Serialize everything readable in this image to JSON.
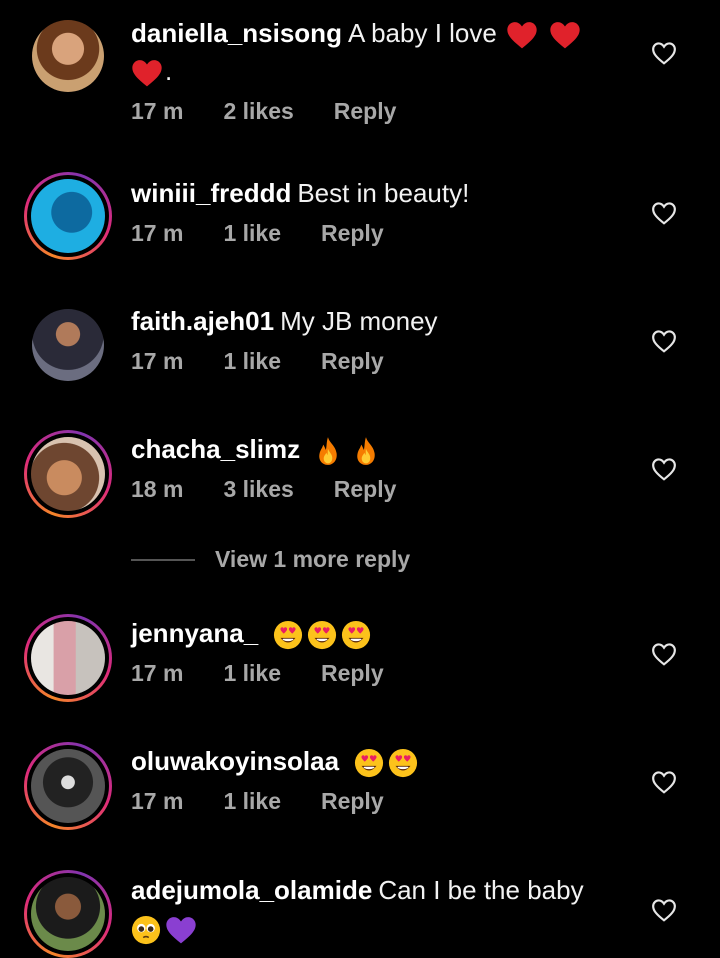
{
  "comments": [
    {
      "username": "daniella_nsisong",
      "text": "A baby I love",
      "suffix": ".",
      "time": "17 m",
      "likes": "2 likes",
      "reply": "Reply"
    },
    {
      "username": "winiii_freddd",
      "text": "Best in beauty!",
      "time": "17 m",
      "likes": "1 like",
      "reply": "Reply"
    },
    {
      "username": "faith.ajeh01",
      "text": "My JB money",
      "time": "17 m",
      "likes": "1 like",
      "reply": "Reply"
    },
    {
      "username": "chacha_slimz",
      "text": "",
      "time": "18 m",
      "likes": "3 likes",
      "reply": "Reply"
    },
    {
      "username": "jennyana_",
      "text": "",
      "time": "17 m",
      "likes": "1 like",
      "reply": "Reply"
    },
    {
      "username": "oluwakoyinsolaa",
      "text": "",
      "time": "17 m",
      "likes": "1 like",
      "reply": "Reply"
    },
    {
      "username": "adejumola_olamide",
      "text": "Can I be the baby"
    }
  ],
  "view_more": "View 1 more reply",
  "icons": {
    "like": "heart-outline-icon",
    "emoji_heart": "red-heart-emoji",
    "emoji_fire": "fire-emoji",
    "emoji_heart_eyes": "heart-eyes-emoji",
    "emoji_pleading": "pleading-face-emoji",
    "emoji_purple_heart": "purple-heart-emoji"
  },
  "colors": {
    "background": "#000000",
    "meta": "#a8a8a8",
    "ring_start": "#f58529",
    "ring_end": "#dd2a7b"
  }
}
